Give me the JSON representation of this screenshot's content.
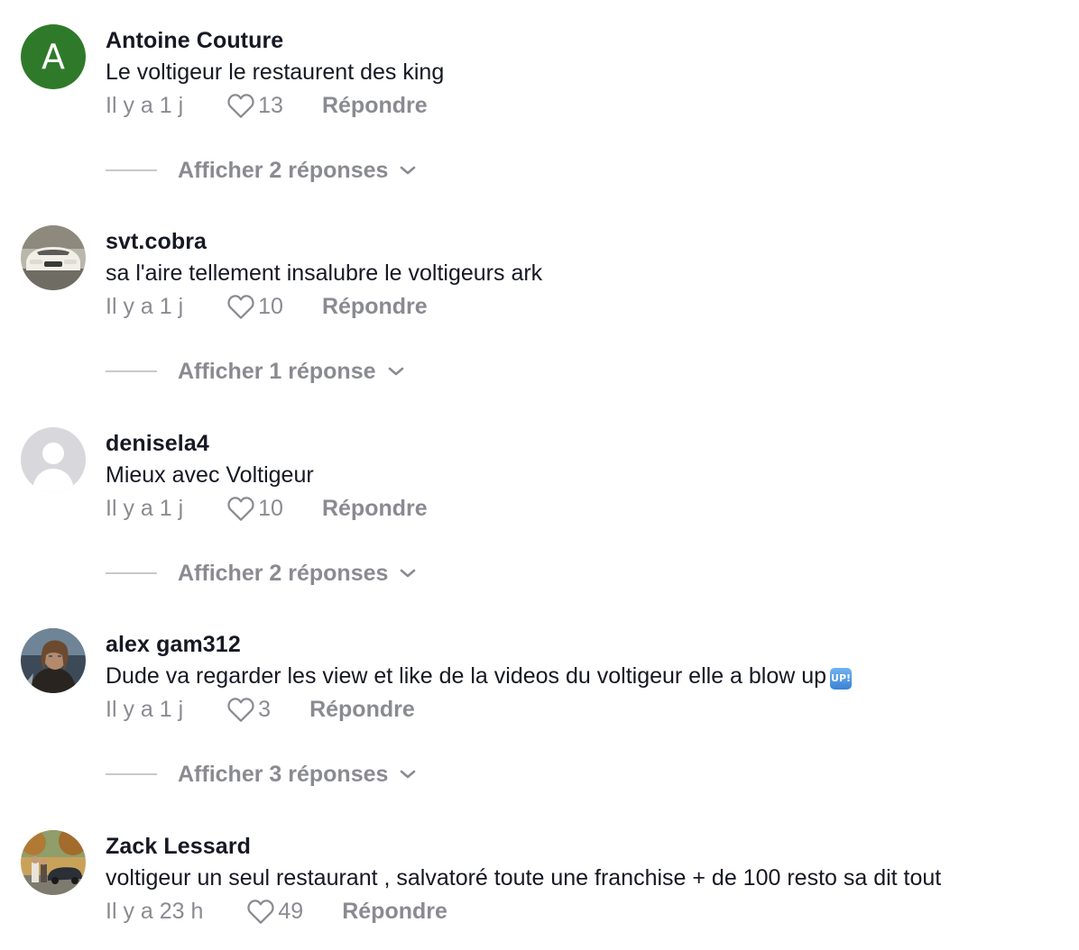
{
  "comments": [
    {
      "username": "Antoine Couture",
      "avatar_letter": "A",
      "text": "Le voltigeur le restaurent des king",
      "time": "Il y a 1 j",
      "likes": "13",
      "reply_label": "Répondre",
      "replies_label": "Afficher 2 réponses"
    },
    {
      "username": "svt.cobra",
      "text": "sa l'aire tellement insalubre le voltigeurs ark",
      "time": "Il y a 1 j",
      "likes": "10",
      "reply_label": "Répondre",
      "replies_label": "Afficher 1 réponse"
    },
    {
      "username": "denisela4",
      "text": "Mieux avec Voltigeur",
      "time": "Il y a 1 j",
      "likes": "10",
      "reply_label": "Répondre",
      "replies_label": "Afficher 2 réponses"
    },
    {
      "username": "alex gam312",
      "text": "Dude va regarder les view et like de la videos du voltigeur elle a blow up",
      "emoji_label": "UP!",
      "time": "Il y a 1 j",
      "likes": "3",
      "reply_label": "Répondre",
      "replies_label": "Afficher 3 réponses"
    },
    {
      "username": "Zack Lessard",
      "text": "voltigeur un seul restaurant , salvatoré toute une franchise + de 100 resto sa dit tout",
      "time": "Il y a 23 h",
      "likes": "49",
      "reply_label": "Répondre"
    }
  ],
  "colors": {
    "primary_text": "#161823",
    "secondary_text": "#8a8b91",
    "avatar_green": "#2f7a2a"
  },
  "icons": {
    "like": "heart-outline-icon",
    "expand": "chevron-down-icon"
  }
}
